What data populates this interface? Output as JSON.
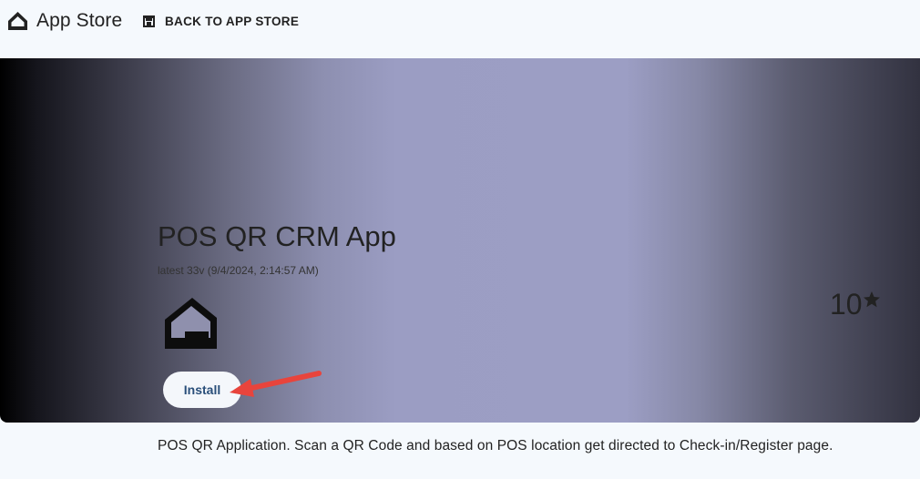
{
  "header": {
    "app_title": "App Store",
    "brand_icon": "home-icon",
    "back_label": "BACK TO APP STORE",
    "back_icon": "store-icon"
  },
  "app": {
    "name": "POS QR CRM App",
    "version": "latest 33v (9/4/2024, 2:14:57 AM)",
    "logo_icon": "house-logo-icon",
    "rating": "10",
    "rating_icon": "star-icon",
    "install_label": "Install",
    "description": "POS QR Application. Scan a QR Code and based on POS location get directed to Check-in/Register page."
  },
  "annotation": {
    "arrow_color": "#e8443c",
    "arrow_icon": "arrow-pointer-icon"
  },
  "colors": {
    "page_background": "#f5f9fd",
    "text": "#222222",
    "install_text": "#2a4f7a",
    "hero_center": "#9c9ec4"
  }
}
